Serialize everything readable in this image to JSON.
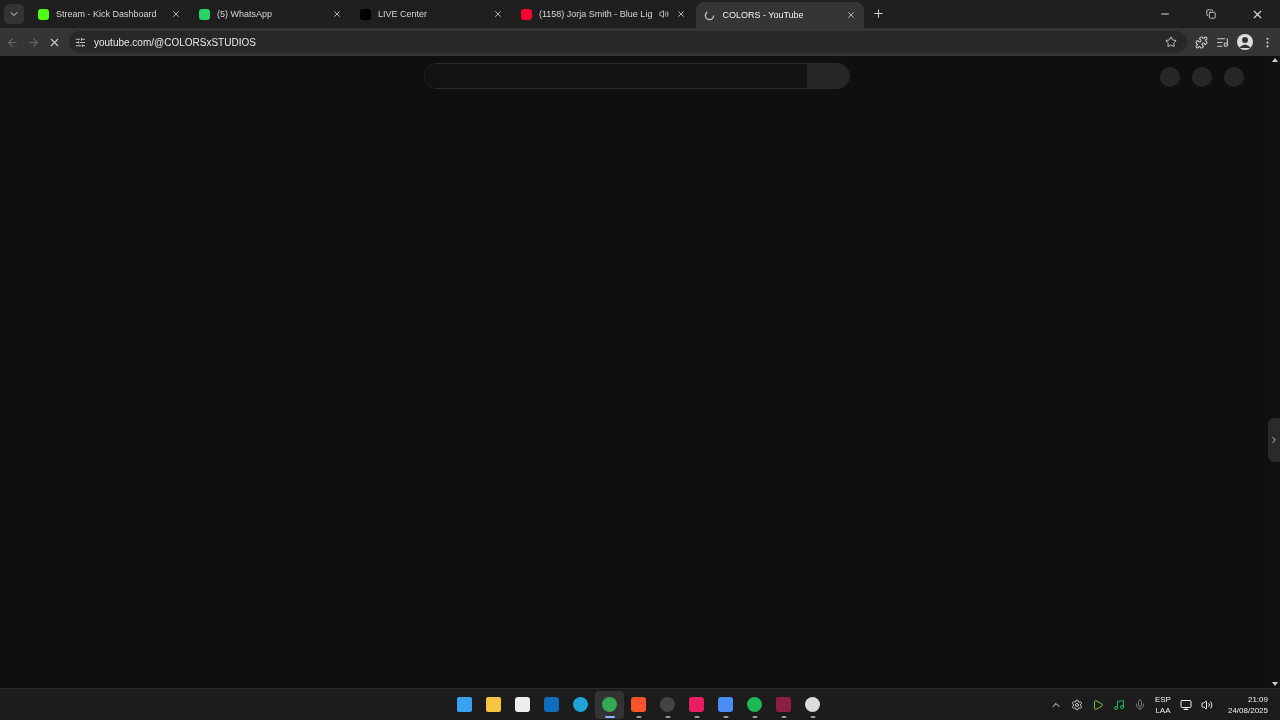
{
  "tabs": [
    {
      "title": "Stream - Kick Dashboard",
      "kind": "kick",
      "selected": false,
      "audio": false
    },
    {
      "title": "(5) WhatsApp",
      "kind": "whatsapp",
      "selected": false,
      "audio": false
    },
    {
      "title": "LIVE Center",
      "kind": "tiktok",
      "selected": false,
      "audio": false
    },
    {
      "title": "(1158) Jorja Smith - Blue Lig",
      "kind": "youtube",
      "selected": false,
      "audio": true
    },
    {
      "title": "COLORS - YouTube",
      "kind": "loading",
      "selected": true,
      "audio": false
    }
  ],
  "address_bar": {
    "url": "youtube.com/@COLORSxSTUDIOS",
    "loading": true
  },
  "taskbar": {
    "apps": [
      {
        "kind": "start",
        "running": false,
        "selected": false
      },
      {
        "kind": "folder",
        "running": false,
        "selected": false
      },
      {
        "kind": "store",
        "running": false,
        "selected": false
      },
      {
        "kind": "mail",
        "running": false,
        "selected": false
      },
      {
        "kind": "edge",
        "running": false,
        "selected": false
      },
      {
        "kind": "chrome",
        "running": true,
        "selected": true
      },
      {
        "kind": "brave",
        "running": true,
        "selected": false
      },
      {
        "kind": "obs",
        "running": true,
        "selected": false
      },
      {
        "kind": "tiktok",
        "running": true,
        "selected": false
      },
      {
        "kind": "studio",
        "running": true,
        "selected": false
      },
      {
        "kind": "spotify",
        "running": true,
        "selected": false
      },
      {
        "kind": "tf",
        "running": true,
        "selected": false
      },
      {
        "kind": "steelseries",
        "running": true,
        "selected": false
      }
    ],
    "language": [
      "ESP",
      "LAA"
    ],
    "time": "21:09",
    "date": "24/08/2025"
  }
}
